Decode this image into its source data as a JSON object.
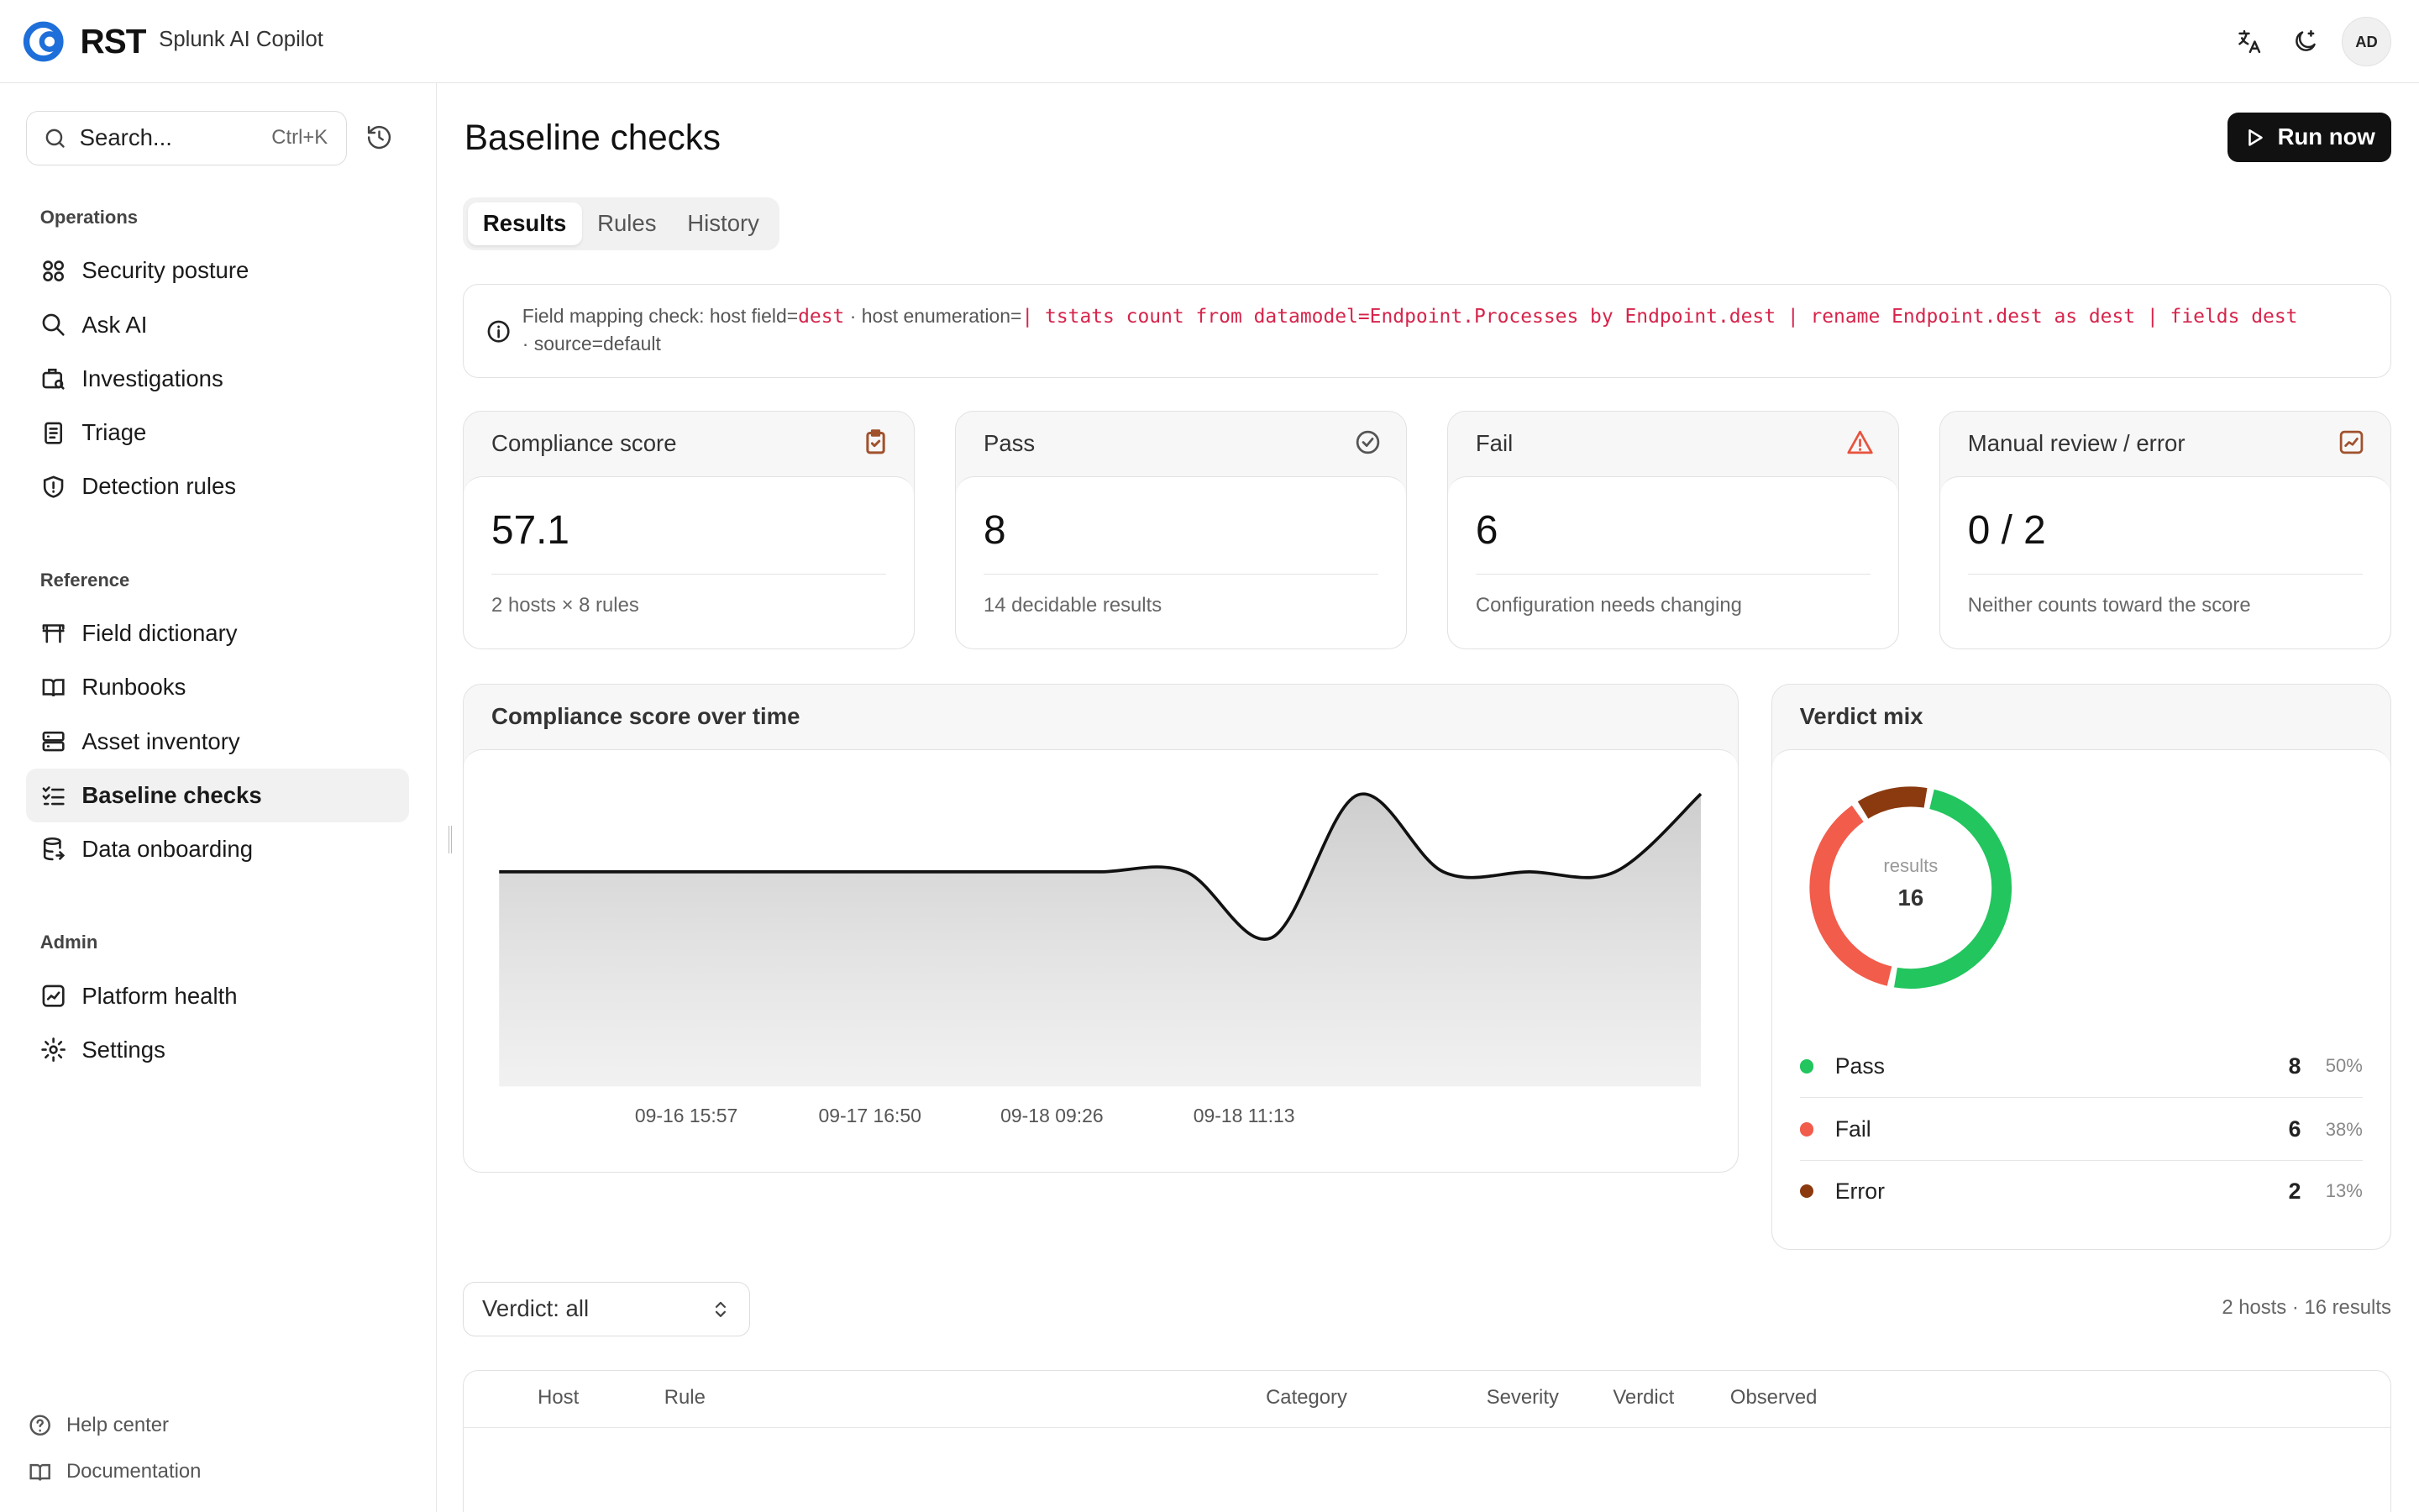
{
  "header": {
    "logo_text": "RST",
    "app_name": "Splunk AI Copilot",
    "avatar_initials": "AD",
    "icons": [
      "translate-icon",
      "theme-toggle-icon"
    ]
  },
  "sidebar": {
    "search_placeholder": "Search...",
    "search_shortcut": "Ctrl+K",
    "sections": [
      {
        "label": "Operations"
      },
      {
        "label": "Reference"
      },
      {
        "label": "Admin"
      }
    ],
    "items": [
      {
        "label": "Security posture",
        "icon": "grid-icon"
      },
      {
        "label": "Ask AI",
        "icon": "search-icon"
      },
      {
        "label": "Investigations",
        "icon": "briefcase-search-icon"
      },
      {
        "label": "Triage",
        "icon": "clipboard-list-icon"
      },
      {
        "label": "Detection rules",
        "icon": "shield-alert-icon"
      },
      {
        "label": "Field dictionary",
        "icon": "table-icon"
      },
      {
        "label": "Runbooks",
        "icon": "book-open-icon"
      },
      {
        "label": "Asset inventory",
        "icon": "server-icon"
      },
      {
        "label": "Baseline checks",
        "icon": "list-checks-icon",
        "active": true
      },
      {
        "label": "Data onboarding",
        "icon": "database-import-icon"
      },
      {
        "label": "Platform health",
        "icon": "activity-chart-icon"
      },
      {
        "label": "Settings",
        "icon": "gear-icon"
      }
    ],
    "footer": [
      {
        "label": "Help center",
        "icon": "help-circle-icon"
      },
      {
        "label": "Documentation",
        "icon": "book-icon"
      }
    ]
  },
  "page": {
    "title": "Baseline checks",
    "run_button": "Run now",
    "tabs": [
      "Results",
      "Rules",
      "History"
    ],
    "active_tab": "Results"
  },
  "notice": {
    "prefix": "Field mapping check: host field=",
    "host_field": "dest",
    "mid": " · host enumeration=",
    "enumeration": "| tstats count from datamodel=Endpoint.Processes by Endpoint.dest | rename Endpoint.dest as dest | fields dest",
    "line2": "· source=default"
  },
  "stats": [
    {
      "title": "Compliance score",
      "value": "57.1",
      "sub": "2 hosts × 8 rules",
      "icon": "clipboard-check-icon",
      "icon_color": "#a0522d"
    },
    {
      "title": "Pass",
      "value": "8",
      "sub": "14 decidable results",
      "icon": "check-circle-icon",
      "icon_color": "#555555"
    },
    {
      "title": "Fail",
      "value": "6",
      "sub": "Configuration needs changing",
      "icon": "alert-triangle-icon",
      "icon_color": "#e8533f"
    },
    {
      "title": "Manual review / error",
      "value": "0 / 2",
      "sub": "Neither counts toward the score",
      "icon": "chart-line-icon",
      "icon_color": "#a0522d"
    }
  ],
  "chart_data": [
    {
      "type": "area",
      "title": "Compliance score over time",
      "x_ticks": [
        "09-16 15:57",
        "09-17 16:50",
        "09-18 09:26",
        "09-18 11:13"
      ],
      "series": [
        {
          "values": [
            50,
            50,
            50,
            50,
            50,
            50,
            50,
            50,
            50,
            44,
            57,
            50,
            50,
            50,
            57.1
          ]
        }
      ],
      "grid": false
    },
    {
      "type": "pie",
      "title": "Verdict mix",
      "center_label": "results",
      "center_value": "16",
      "slices": [
        {
          "label": "Pass",
          "value": 8,
          "pct": "50%",
          "color": "#22c55e"
        },
        {
          "label": "Fail",
          "value": 6,
          "pct": "38%",
          "color": "#f25c4b"
        },
        {
          "label": "Error",
          "value": 2,
          "pct": "13%",
          "color": "#8b3a0f"
        }
      ]
    }
  ],
  "filter": {
    "verdict_select": "Verdict: all",
    "summary": "2 hosts · 16 results"
  },
  "table": {
    "columns": [
      "Host",
      "Rule",
      "Category",
      "Severity",
      "Verdict",
      "Observed"
    ]
  }
}
